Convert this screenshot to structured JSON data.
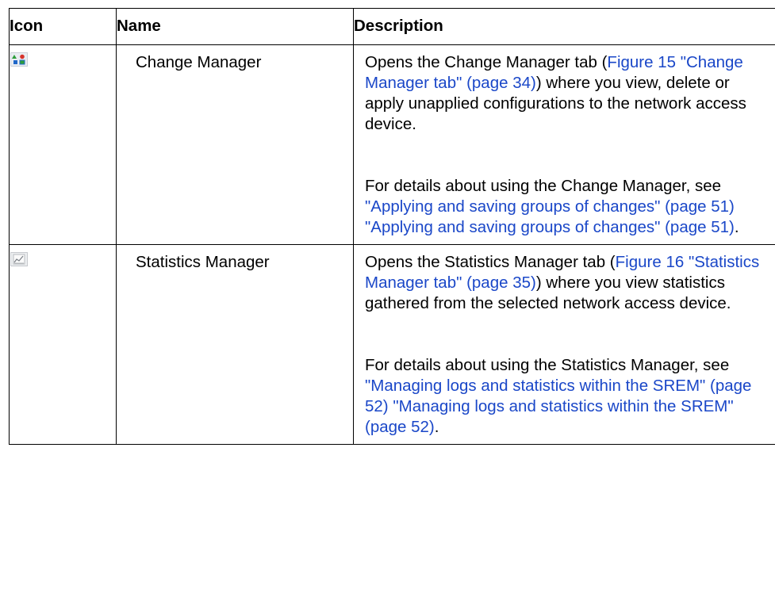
{
  "table": {
    "headers": {
      "icon": "Icon",
      "name": "Name",
      "description": "Description"
    },
    "rows": [
      {
        "icon": "change-manager-icon",
        "name": "Change Manager",
        "p1": {
          "text1": "Opens the Change Manager tab (",
          "link1": "Figure 15 \"Change Manager tab\" (page 34)",
          "text2": ") where you view, delete or apply unapplied configurations to the network access device."
        },
        "p2": {
          "text1": "For details about using the Change Manager, see ",
          "link1": "\"Applying and saving groups of changes\" (page 51)",
          "text2": " ",
          "link2": "\"Applying and saving groups of changes\" (page 51)",
          "text3": "."
        }
      },
      {
        "icon": "statistics-manager-icon",
        "name": "Statistics Manager",
        "p1": {
          "text1": "Opens the Statistics Manager tab (",
          "link1": "Figure 16 \"Statistics Manager tab\" (page 35)",
          "text2": ") where you view statistics gathered from the selected network access device."
        },
        "p2": {
          "text1": "For details about using the Statistics Manager, see ",
          "link1": "\"Managing logs and statistics within the SREM\" (page 52)",
          "text2": " ",
          "link2": "\"Managing logs and statistics within the SREM\" (page 52)",
          "text3": "."
        }
      }
    ]
  }
}
